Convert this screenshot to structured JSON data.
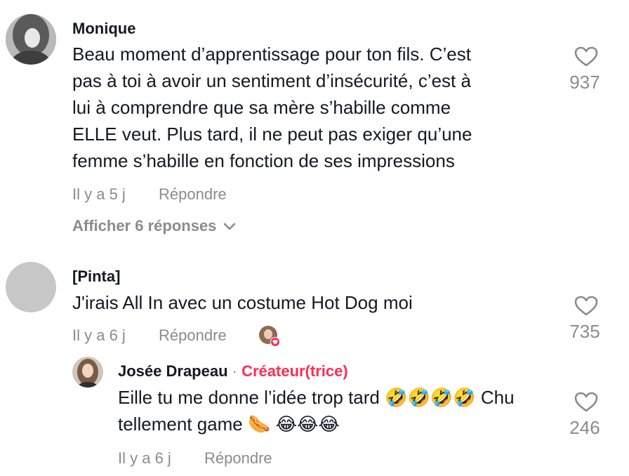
{
  "comments": [
    {
      "username": "Monique",
      "text_lines": [
        "Beau moment d’apprentissage pour ton fils. C’est",
        "pas à toi à avoir un sentiment d’insécurité, c’est à",
        "lui à comprendre que sa mère s’habille comme",
        "ELLE veut. Plus tard, il ne peut pas exiger qu’une",
        "femme s’habille en fonction de ses impressions"
      ],
      "time": "Il y a 5 j",
      "reply_label": "Répondre",
      "likes": "937",
      "show_replies": "Afficher 6 réponses"
    },
    {
      "username": "[Pinta]",
      "text": "J'irais All In avec un costume Hot Dog moi",
      "time": "Il y a 6 j",
      "reply_label": "Répondre",
      "likes": "735"
    }
  ],
  "reply": {
    "username": "Josée Drapeau",
    "separator": "·",
    "creator_label": "Créateur(trice)",
    "text_line1": "Eille tu me donne l’idée trop tard 🤣🤣🤣🤣 Chu",
    "text_line2": "tellement game 🌭 😂😂😂",
    "time": "Il y a 6 j",
    "reply_label": "Répondre",
    "likes": "246"
  },
  "colors": {
    "accent": "#fe2c55",
    "muted": "#8a8b91",
    "text": "#161823"
  },
  "icons": [
    "heart-outline-icon",
    "chevron-down-icon",
    "creator-liked-heart-icon"
  ]
}
